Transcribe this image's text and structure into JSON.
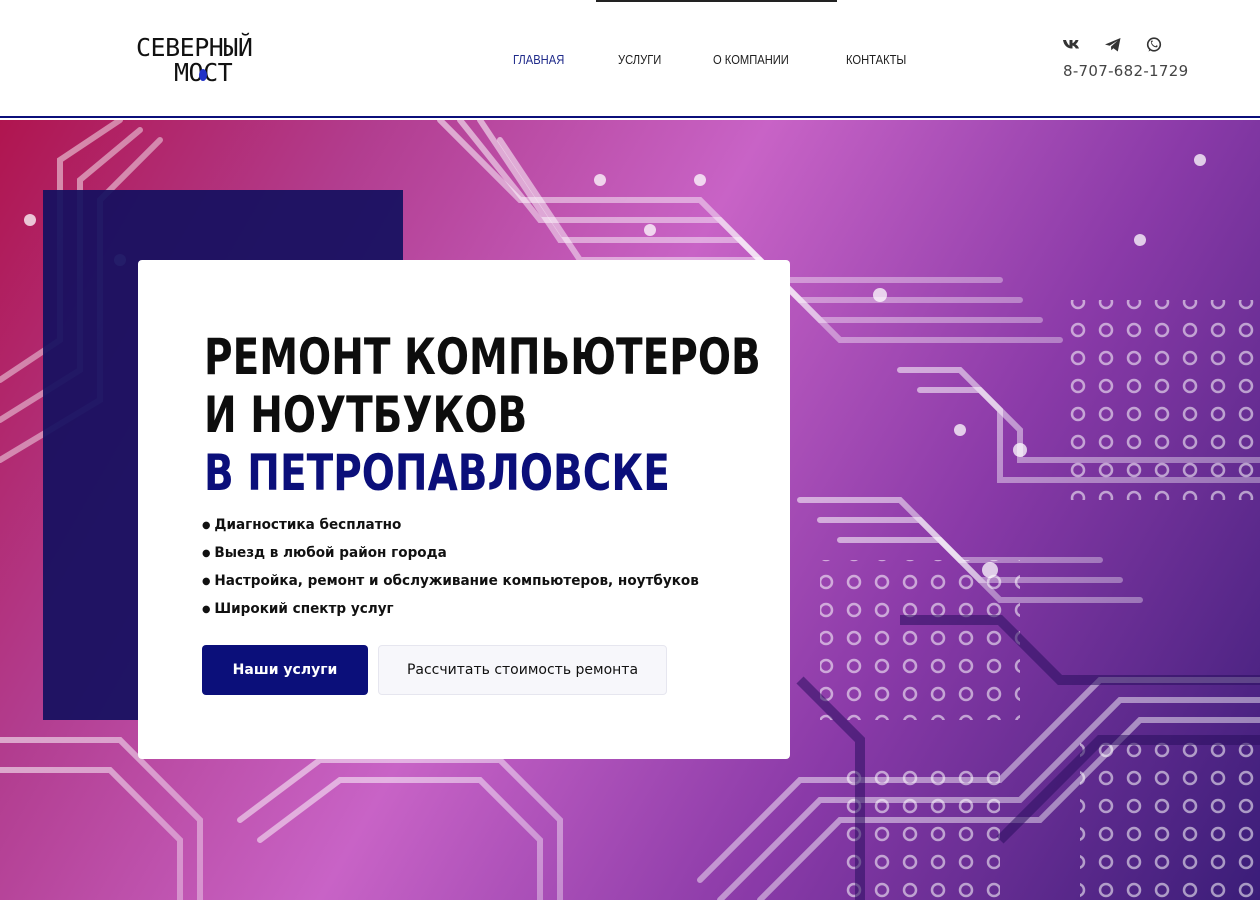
{
  "header": {
    "logo_line1": "СЕВЕРНЫЙ",
    "logo_line2": "МОСТ",
    "nav": [
      {
        "label": "Главная",
        "active": true
      },
      {
        "label": "Услуги",
        "active": false
      },
      {
        "label": "О компании",
        "active": false
      },
      {
        "label": "Контакты",
        "active": false
      }
    ],
    "socials": [
      {
        "icon": "vk-icon"
      },
      {
        "icon": "telegram-icon"
      },
      {
        "icon": "whatsapp-icon"
      }
    ],
    "phone": "8-707-682-1729"
  },
  "hero": {
    "headline_line1": "РЕМОНТ КОМПЬЮТЕРОВ",
    "headline_line2": "И НОУТБУКОВ",
    "headline_line3": "В ПЕТРОПАВЛОВСКЕ",
    "bullets": [
      "Диагностика бесплатно",
      "Выезд в любой район города",
      "Настройка, ремонт и обслуживание компьютеров, ноутбуков",
      "Широкий спектр услуг"
    ],
    "primary_button": "Наши услуги",
    "secondary_button": "Рассчитать стоимость ремонта"
  },
  "colors": {
    "accent": "#0b0f7a",
    "nav_active": "#1f2a8a",
    "background_theme": "magenta circuit board"
  }
}
